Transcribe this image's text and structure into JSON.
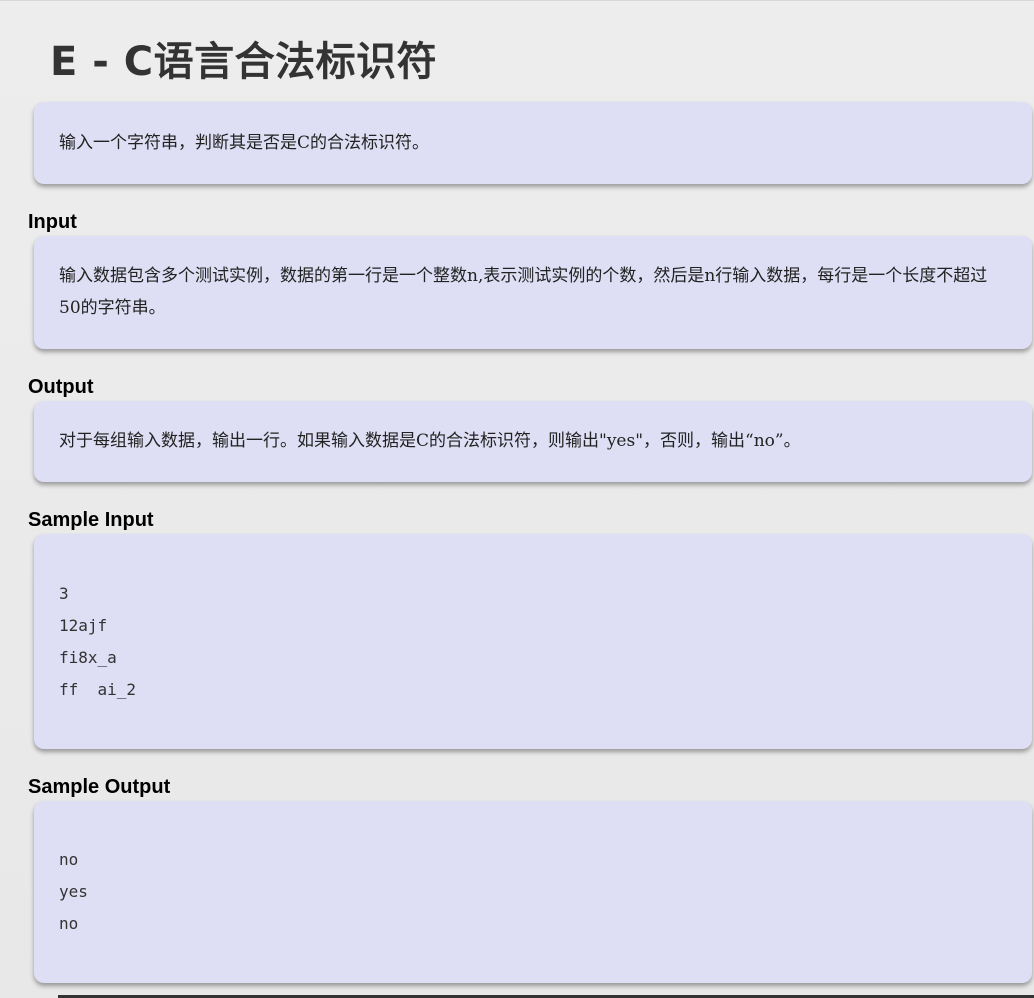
{
  "problem": {
    "title": "E - C语言合法标识符",
    "description": "输入一个字符串，判断其是否是C的合法标识符。"
  },
  "sections": {
    "input_label": "Input",
    "input_text": "输入数据包含多个测试实例，数据的第一行是一个整数n,表示测试实例的个数，然后是n行输入数据，每行是一个长度不超过50的字符串。",
    "output_label": "Output",
    "output_text": "对于每组输入数据，输出一行。如果输入数据是C的合法标识符，则输出\"yes\"，否则，输出“no”。",
    "sample_input_label": "Sample Input",
    "sample_input_lines": [
      "3",
      "12ajf",
      "fi8x_a",
      "ff  ai_2"
    ],
    "sample_output_label": "Sample Output",
    "sample_output_lines": [
      "no",
      "yes",
      "no"
    ]
  },
  "colors": {
    "panel_background": "#dedef4",
    "page_background": "#ececec"
  }
}
